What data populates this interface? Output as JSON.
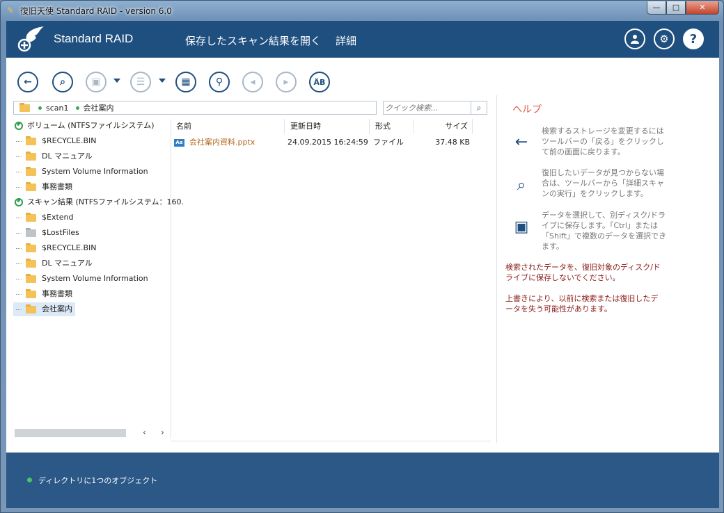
{
  "window": {
    "title": "復旧天使 Standard RAID - version 6.0",
    "buttons": {
      "minimize": "—",
      "maximize": "□",
      "close": "✕"
    }
  },
  "header": {
    "brand": "Standard RAID",
    "menu": [
      {
        "label": "保存したスキャン結果を開く"
      },
      {
        "label": "詳細"
      }
    ],
    "icons": [
      "user-icon",
      "gear-icon",
      "help-icon"
    ]
  },
  "toolbar": {
    "items": [
      {
        "name": "back-button",
        "icon": "←",
        "enabled": true
      },
      {
        "name": "deep-scan-button",
        "icon": "⌕",
        "enabled": true
      },
      {
        "name": "save-button",
        "icon": "▣",
        "enabled": false
      },
      {
        "name": "view-list-button",
        "icon": "☰",
        "enabled": false
      },
      {
        "name": "preview-button",
        "icon": "▦",
        "enabled": true
      },
      {
        "name": "find-button",
        "icon": "⚲",
        "enabled": true
      },
      {
        "name": "prev-button",
        "icon": "◂",
        "enabled": false
      },
      {
        "name": "next-button",
        "icon": "▸",
        "enabled": false
      },
      {
        "name": "encoding-button",
        "icon": "ÄB",
        "enabled": true
      }
    ]
  },
  "path": {
    "segments": [
      "scan1",
      "会社案内"
    ]
  },
  "search": {
    "placeholder": "クイック検索..."
  },
  "tree": {
    "items": [
      {
        "type": "volume",
        "label": "ボリューム (NTFSファイルシステム)"
      },
      {
        "type": "folder",
        "label": "$RECYCLE.BIN"
      },
      {
        "type": "folder",
        "label": "DL マニュアル"
      },
      {
        "type": "folder",
        "label": "System Volume Information"
      },
      {
        "type": "folder",
        "label": "事務書類"
      },
      {
        "type": "volume",
        "label": "スキャン結果 (NTFSファイルシステム：160."
      },
      {
        "type": "folder",
        "label": "$Extend"
      },
      {
        "type": "folder-gray",
        "label": "$LostFiles"
      },
      {
        "type": "folder",
        "label": "$RECYCLE.BIN"
      },
      {
        "type": "folder",
        "label": "DL マニュアル"
      },
      {
        "type": "folder",
        "label": "System Volume Information"
      },
      {
        "type": "folder",
        "label": "事務書類"
      },
      {
        "type": "folder",
        "label": "会社案内",
        "selected": true
      }
    ]
  },
  "filelist": {
    "columns": [
      "名前",
      "更新日時",
      "形式",
      "サイズ"
    ],
    "rows": [
      {
        "icon": "Aa",
        "name": "会社案内資料.pptx",
        "date": "24.09.2015 16:24:59",
        "type": "ファイル",
        "size": "37.48 KB"
      }
    ]
  },
  "help": {
    "title": "ヘルプ",
    "items": [
      {
        "icon": "arrow-left-icon",
        "glyph": "←",
        "text": "検索するストレージを変更するにはツールバーの「戻る」をクリックして前の画面に戻ります。"
      },
      {
        "icon": "magnifier-icon",
        "glyph": "⌕",
        "text": "復旧したいデータが見つからない場合は、ツールバーから「詳細スキャンの実行」をクリックします。"
      },
      {
        "icon": "floppy-icon",
        "glyph": "▣",
        "text": "データを選択して、別ディスク/ドライブに保存します。「Ctrl」または「Shift」で複数のデータを選択できます。"
      }
    ],
    "warnings": [
      "検索されたデータを、復旧対象のディスク/ドライブに保存しないでください。",
      "上書きにより、以前に検索または復旧したデータを失う可能性があります。"
    ]
  },
  "status": {
    "text": "ディレクトリに1つのオブジェクト"
  },
  "colors": {
    "header": "#1f4f7f",
    "status": "#2b5886",
    "help_title": "#e15b4a",
    "warning": "#8b1a1a",
    "ok": "#3aa856"
  }
}
